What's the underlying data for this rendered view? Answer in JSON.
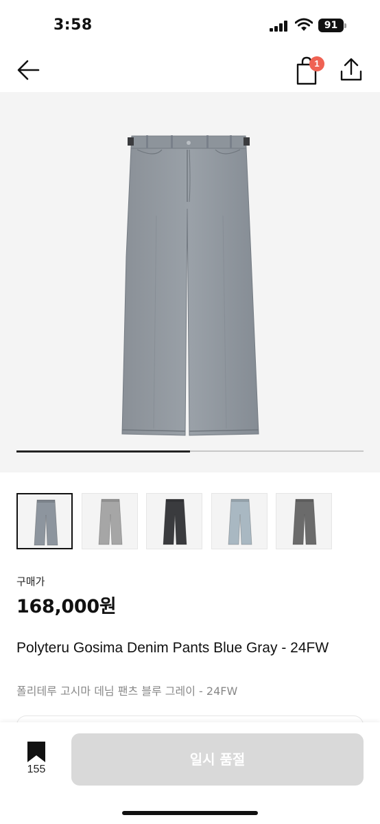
{
  "status_bar": {
    "time": "3:58",
    "battery_level": "91",
    "icons": [
      "cellular-signal-icon",
      "wifi-icon",
      "battery-icon"
    ]
  },
  "header": {
    "icons": [
      "back-arrow-icon",
      "shopping-bag-icon",
      "share-icon"
    ],
    "cart_badge_count": "1",
    "badge_color": "#ef6253"
  },
  "gallery": {
    "progress_fraction": 0.5,
    "thumbnails": [
      {
        "color": "#8d959e",
        "selected": true
      },
      {
        "color": "#a6a6a6",
        "selected": false
      },
      {
        "color": "#3a3b3e",
        "selected": false
      },
      {
        "color": "#a9b8c2",
        "selected": false
      },
      {
        "color": "#6b6b6b",
        "selected": false
      }
    ]
  },
  "product": {
    "price_label": "구매가",
    "price": "168,000원",
    "name_en": "Polyteru Gosima Denim Pants Blue Gray - 24FW",
    "name_kr": "폴리테루 고시마 데님 팬츠 블루 그레이 - 24FW"
  },
  "bottom_bar": {
    "wish_count": "155",
    "sold_out_label": "일시 품절",
    "icons": [
      "bookmark-icon"
    ]
  }
}
